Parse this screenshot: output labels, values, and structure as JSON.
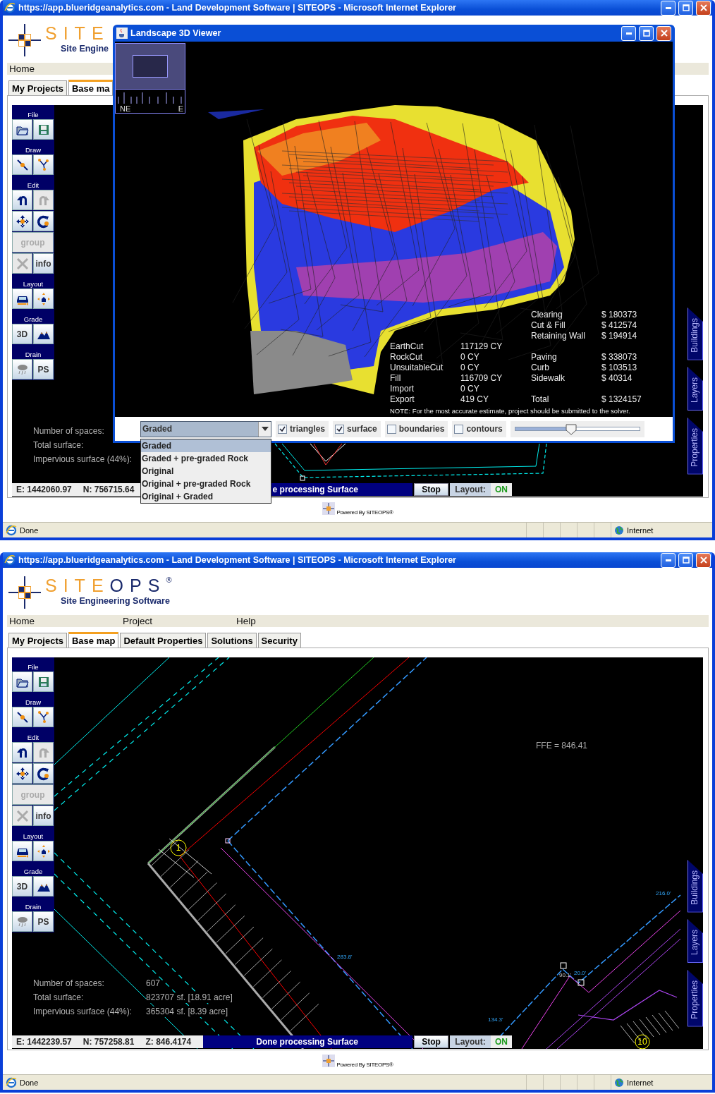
{
  "windows": [
    {
      "title": "https://app.blueridgeanalytics.com - Land Development Software | SITEOPS - Microsoft Internet Explorer",
      "page": {
        "logo": {
          "first_part": "SITE",
          "tagline": "Site Engine"
        },
        "menu": [
          "Home"
        ],
        "tabs": [
          {
            "label": "My Projects",
            "selected": false
          },
          {
            "label": "Base ma",
            "selected": true
          }
        ],
        "toolbar": [
          {
            "title": "File",
            "buttons": [
              {
                "kind": "icon",
                "disabled": false
              },
              {
                "kind": "icon",
                "disabled": false
              }
            ]
          },
          {
            "title": "Draw",
            "buttons": [
              {
                "kind": "icon",
                "disabled": false
              },
              {
                "kind": "icon",
                "disabled": false
              }
            ]
          },
          {
            "title": "Edit",
            "buttons": [
              {
                "kind": "icon",
                "disabled": false
              },
              {
                "kind": "icon",
                "disabled": true
              },
              {
                "kind": "icon",
                "disabled": false
              },
              {
                "kind": "icon",
                "disabled": false
              },
              {
                "kind": "wide",
                "label": "group",
                "disabled": true
              },
              {
                "kind": "icon",
                "disabled": true
              },
              {
                "kind": "text",
                "label": "info",
                "disabled": false
              }
            ]
          },
          {
            "title": "Layout",
            "buttons": [
              {
                "kind": "icon",
                "disabled": false
              },
              {
                "kind": "icon",
                "disabled": false
              }
            ]
          },
          {
            "title": "Grade",
            "buttons": [
              {
                "kind": "text",
                "label": "3D",
                "disabled": false
              },
              {
                "kind": "icon",
                "disabled": false
              }
            ]
          },
          {
            "title": "Drain",
            "buttons": [
              {
                "kind": "icon",
                "disabled": false
              },
              {
                "kind": "text",
                "label": "PS",
                "disabled": false
              }
            ]
          }
        ],
        "side_tabs": [
          "Buildings",
          "Layers",
          "Properties"
        ],
        "summary": [
          {
            "label": "Number of spaces:"
          },
          {
            "label": "Total surface:"
          },
          {
            "label": "Impervious surface (44%):"
          }
        ],
        "coordinates": [
          "E: 1442060.97",
          "N: 756715.64"
        ],
        "progress": {
          "text": "e processing Surface",
          "level": 1
        },
        "stop_button": "Stop",
        "layout_label": "Layout:",
        "layout_state": "ON",
        "footer": "Powered By SITEOPS®"
      },
      "viewer": {
        "title": "Landscape 3D Viewer",
        "compass": [
          "NE",
          "E"
        ],
        "quantities": [
          {
            "label": "EarthCut",
            "value": "117129 CY"
          },
          {
            "label": "RockCut",
            "value": "0 CY"
          },
          {
            "label": "UnsuitableCut",
            "value": "0 CY"
          },
          {
            "label": "Fill",
            "value": "116709 CY"
          },
          {
            "label": "Import",
            "value": "0 CY"
          },
          {
            "label": "Export",
            "value": "419 CY"
          }
        ],
        "cost_groups": [
          [
            {
              "label": "Clearing",
              "value": "$ 180373"
            },
            {
              "label": "Cut & Fill",
              "value": "$ 412574"
            },
            {
              "label": "Retaining Wall",
              "value": "$ 194914"
            }
          ],
          [
            {
              "label": "Paving",
              "value": "$ 338073"
            },
            {
              "label": "Curb",
              "value": "$ 103513"
            },
            {
              "label": "Sidewalk",
              "value": "$ 40314"
            }
          ],
          [
            {
              "label": "Total",
              "value": "$ 1324157"
            }
          ]
        ],
        "note": "NOTE: For the most accurate estimate, project should be submitted to the solver.",
        "surface_select": {
          "value": "Graded",
          "expanded": true,
          "options": [
            {
              "label": "Graded",
              "selected": true
            },
            {
              "label": "Graded + pre-graded Rock",
              "selected": false
            },
            {
              "label": "Original",
              "selected": false
            },
            {
              "label": "Original + pre-graded Rock",
              "selected": false
            },
            {
              "label": "Original + Graded",
              "selected": false
            }
          ]
        },
        "toggles": [
          {
            "label": "triangles",
            "checked": true
          },
          {
            "label": "surface",
            "checked": true
          },
          {
            "label": "boundaries",
            "checked": false
          },
          {
            "label": "contours",
            "checked": false
          }
        ],
        "slider": {
          "level": 0.45
        }
      },
      "status_bar": {
        "text": "Done",
        "zone": "Internet"
      }
    },
    {
      "title": "https://app.blueridgeanalytics.com - Land Development Software | SITEOPS - Microsoft Internet Explorer",
      "page": {
        "logo": {
          "first_part": "SITE",
          "second_part": "OPS",
          "mark": "®",
          "tagline": "Site Engineering Software"
        },
        "menu": [
          "Home",
          "Project",
          "Help"
        ],
        "tabs": [
          {
            "label": "My Projects",
            "selected": false
          },
          {
            "label": "Base map",
            "selected": true
          },
          {
            "label": "Default Properties",
            "selected": false
          },
          {
            "label": "Solutions",
            "selected": false
          },
          {
            "label": "Security",
            "selected": false
          }
        ],
        "toolbar": [
          {
            "title": "File",
            "buttons": [
              {
                "kind": "icon",
                "disabled": false
              },
              {
                "kind": "icon",
                "disabled": false
              }
            ]
          },
          {
            "title": "Draw",
            "buttons": [
              {
                "kind": "icon",
                "disabled": false
              },
              {
                "kind": "icon",
                "disabled": false
              }
            ]
          },
          {
            "title": "Edit",
            "buttons": [
              {
                "kind": "icon",
                "disabled": false
              },
              {
                "kind": "icon",
                "disabled": true
              },
              {
                "kind": "icon",
                "disabled": false
              },
              {
                "kind": "icon",
                "disabled": false
              },
              {
                "kind": "wide",
                "label": "group",
                "disabled": true
              },
              {
                "kind": "icon",
                "disabled": true
              },
              {
                "kind": "text",
                "label": "info",
                "disabled": false
              }
            ]
          },
          {
            "title": "Layout",
            "buttons": [
              {
                "kind": "icon",
                "disabled": false
              },
              {
                "kind": "icon",
                "disabled": false
              }
            ]
          },
          {
            "title": "Grade",
            "buttons": [
              {
                "kind": "text",
                "label": "3D",
                "disabled": false
              },
              {
                "kind": "icon",
                "disabled": false
              }
            ]
          },
          {
            "title": "Drain",
            "buttons": [
              {
                "kind": "icon",
                "disabled": false
              },
              {
                "kind": "text",
                "label": "PS",
                "disabled": false
              }
            ]
          }
        ],
        "side_tabs": [
          "Buildings",
          "Layers",
          "Properties"
        ],
        "canvas_labels": [
          {
            "text": "FFE = 846.41"
          },
          {
            "text": "1"
          },
          {
            "text": "216.0'"
          },
          {
            "text": "283.8'"
          },
          {
            "text": "134.3'"
          },
          {
            "text": "90.1'"
          },
          {
            "text": "20.0'"
          },
          {
            "text": "10"
          }
        ],
        "summary": [
          {
            "label": "Number of spaces:",
            "value": "607"
          },
          {
            "label": "Total surface:",
            "value": "823707 sf. [18.91 acre]"
          },
          {
            "label": "Impervious surface (44%):",
            "value": "365304 sf. [8.39 acre]"
          }
        ],
        "coordinates": [
          "E: 1442239.57",
          "N: 757258.81",
          "Z: 846.4174"
        ],
        "progress": {
          "text": "Done processing Surface",
          "level": 1
        },
        "stop_button": "Stop",
        "layout_label": "Layout:",
        "layout_state": "ON",
        "footer": "Powered By SITEOPS®"
      },
      "status_bar": {
        "text": "Done",
        "zone": "Internet"
      }
    }
  ]
}
